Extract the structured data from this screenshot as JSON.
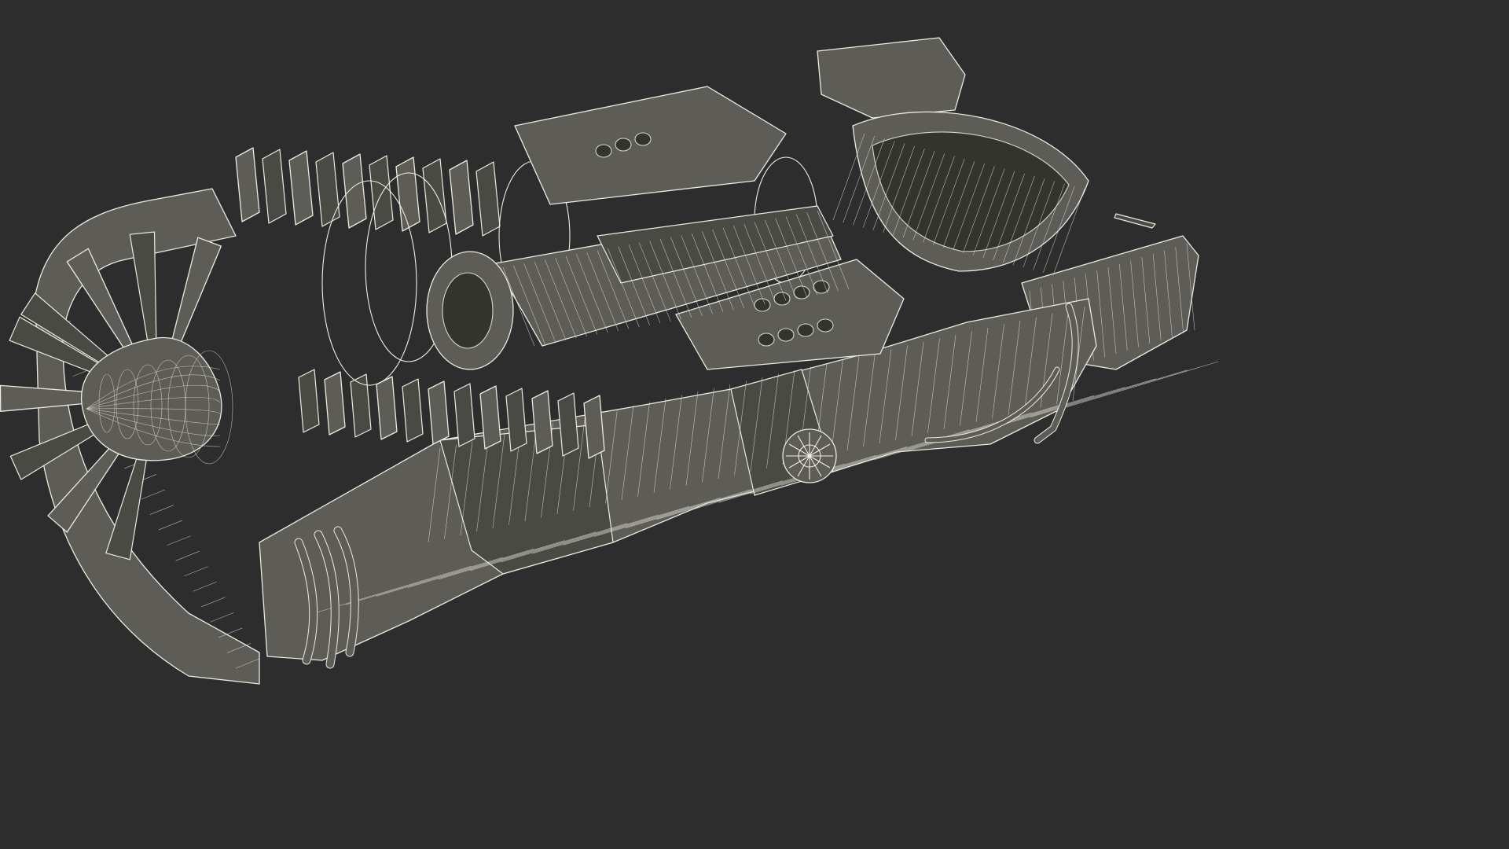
{
  "colors": {
    "background": "#2d2d2d",
    "wireframe": "#ecebe0",
    "surface": "#5d5c56",
    "surface_shadow": "#4a4a45"
  },
  "parts": [
    "nose-spinner",
    "fan-blades",
    "fan-case",
    "compressor-stages",
    "combustion-chamber",
    "turbine-shaft",
    "exhaust-nozzle",
    "outer-casing",
    "fuel-lines",
    "inspection-port"
  ]
}
